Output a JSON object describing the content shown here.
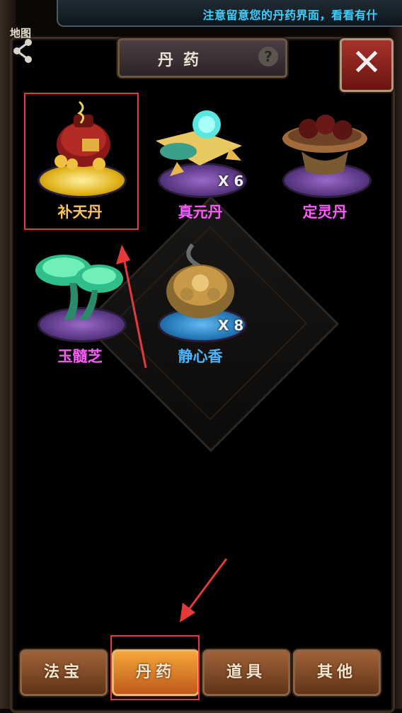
{
  "ticker": {
    "text": "注意留意您的丹药界面，看看有什"
  },
  "map_label": "地图",
  "title": {
    "text": "丹药",
    "help": "?"
  },
  "close": {
    "label": "✕"
  },
  "items": [
    {
      "name": "补天丹",
      "qty": "",
      "name_color": "#ffc15a",
      "disc": "gold",
      "icon": "tonic-pot-icon"
    },
    {
      "name": "真元丹",
      "qty": "X 6",
      "name_color": "#ff5bff",
      "disc": "purple",
      "icon": "jade-orb-icon"
    },
    {
      "name": "定灵丹",
      "qty": "",
      "name_color": "#ff5bff",
      "disc": "purple",
      "icon": "pill-bowl-icon"
    },
    {
      "name": "玉髓芝",
      "qty": "",
      "name_color": "#ff5bff",
      "disc": "purple",
      "icon": "lingzhi-icon"
    },
    {
      "name": "静心香",
      "qty": "X 8",
      "name_color": "#4ab6ff",
      "disc": "blue",
      "icon": "incense-burner-icon"
    }
  ],
  "tabs": [
    {
      "label": "法宝",
      "active": false
    },
    {
      "label": "丹药",
      "active": true
    },
    {
      "label": "道具",
      "active": false
    },
    {
      "label": "其他",
      "active": false
    }
  ]
}
